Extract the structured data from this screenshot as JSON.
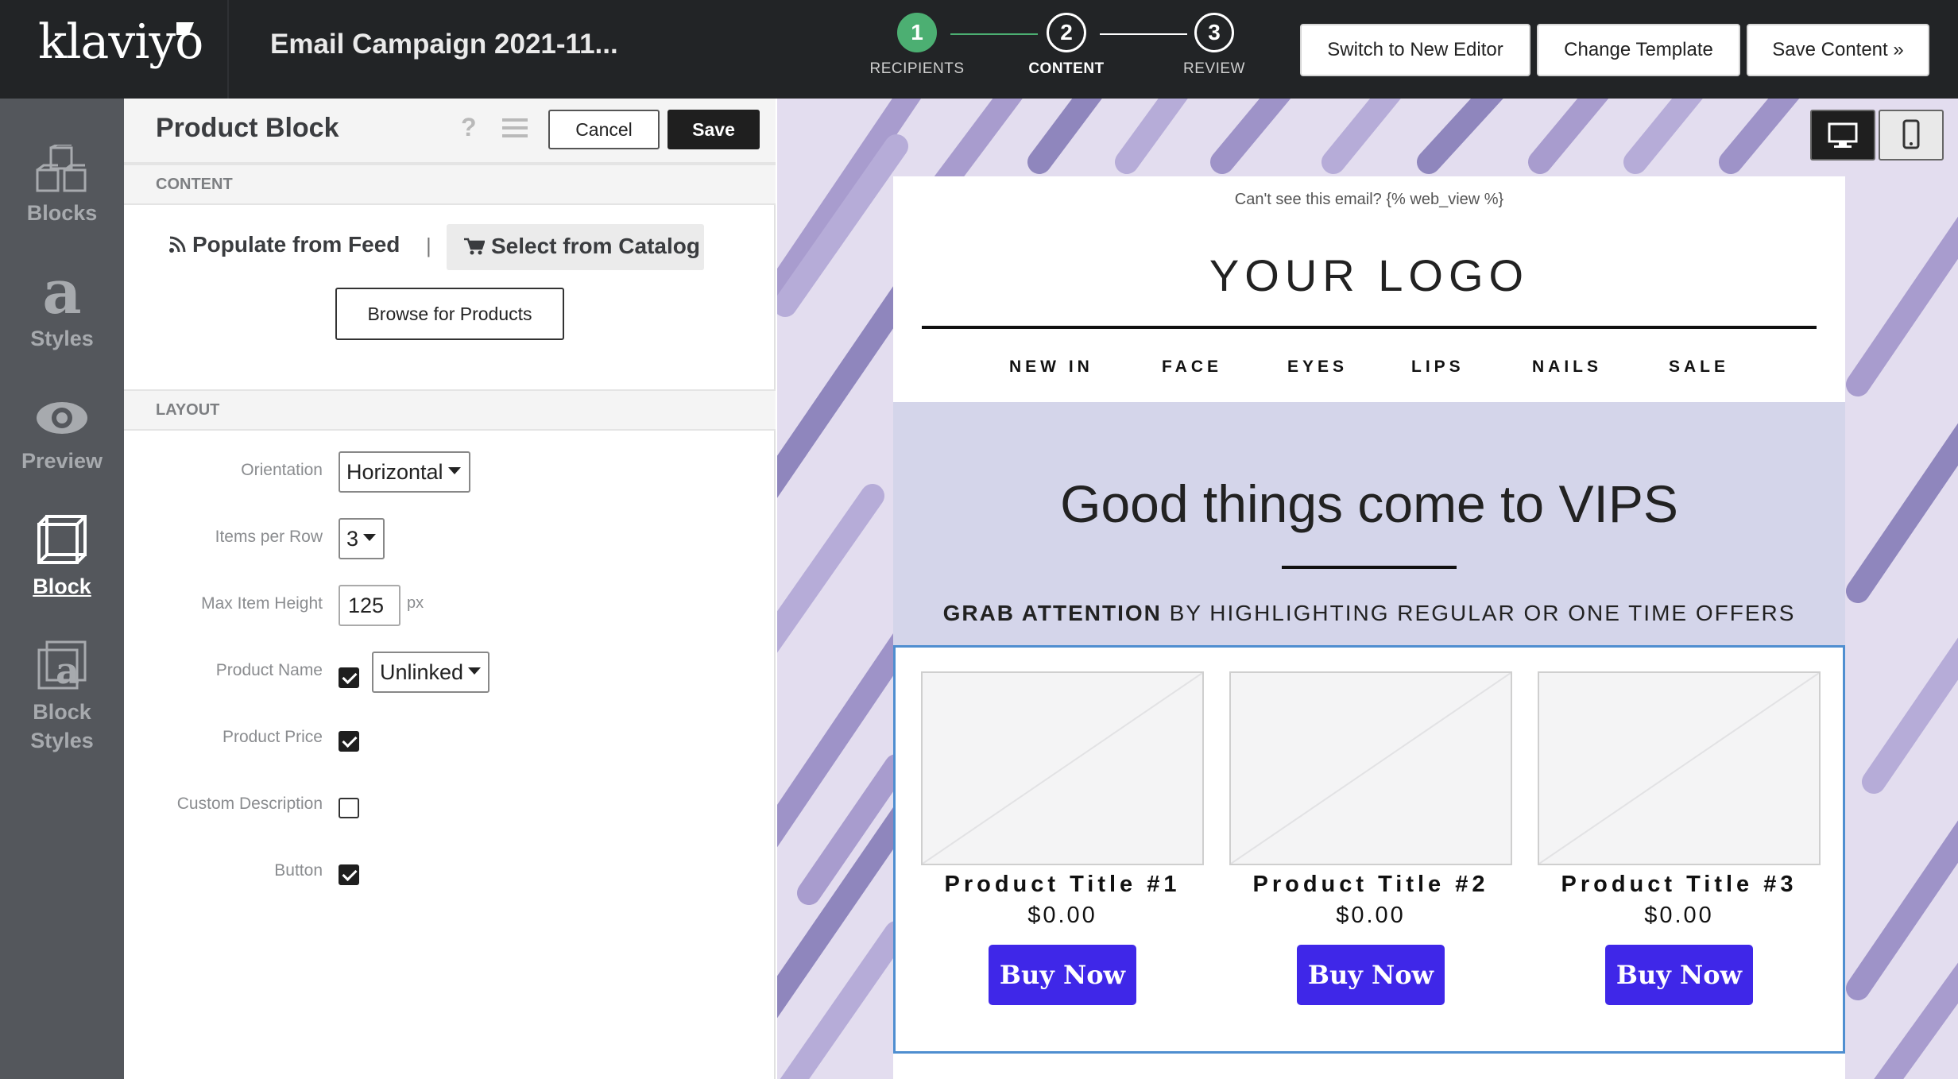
{
  "app": {
    "logo_text": "klaviyo",
    "campaign_title": "Email Campaign 2021-11..."
  },
  "steps": [
    {
      "number": "1",
      "label": "RECIPIENTS",
      "state": "done"
    },
    {
      "number": "2",
      "label": "CONTENT",
      "state": "active"
    },
    {
      "number": "3",
      "label": "REVIEW",
      "state": "todo"
    }
  ],
  "toolbar": {
    "switch_editor": "Switch to New Editor",
    "change_template": "Change Template",
    "save_content": "Save Content »"
  },
  "rail": {
    "items": [
      {
        "label": "Blocks",
        "icon": "blocks-icon"
      },
      {
        "label": "Styles",
        "icon": "styles-icon"
      },
      {
        "label": "Preview",
        "icon": "eye-icon"
      },
      {
        "label": "Block",
        "icon": "cube-icon",
        "active": true
      },
      {
        "label": "Block Styles",
        "icon": "block-styles-icon"
      }
    ]
  },
  "panel": {
    "title": "Product Block",
    "help_glyph": "?",
    "cancel": "Cancel",
    "save": "Save",
    "content_heading": "CONTENT",
    "populate_feed": "Populate from Feed",
    "separator": "|",
    "select_catalog": "Select from Catalog",
    "browse": "Browse for Products",
    "layout_heading": "LAYOUT",
    "fields": {
      "orientation_label": "Orientation",
      "orientation_value": "Horizontal",
      "items_per_row_label": "Items per Row",
      "items_per_row_value": "3",
      "max_height_label": "Max Item Height",
      "max_height_value": "125",
      "max_height_unit": "px",
      "product_name_label": "Product Name",
      "product_name_checked": true,
      "product_name_link": "Unlinked",
      "product_price_label": "Product Price",
      "product_price_checked": true,
      "custom_desc_label": "Custom Description",
      "custom_desc_checked": false,
      "button_label": "Button",
      "button_checked": true
    }
  },
  "email": {
    "webview": "Can't see this email? {% web_view %}",
    "logo": "YOUR LOGO",
    "nav": [
      "NEW IN",
      "FACE",
      "EYES",
      "LIPS",
      "NAILS",
      "SALE"
    ],
    "hero_title": "Good things come to VIPS",
    "hero_sub_bold": "GRAB ATTENTION",
    "hero_sub_rest": " BY HIGHLIGHTING REGULAR OR ONE TIME OFFERS",
    "products": [
      {
        "title": "Product Title #1",
        "price": "$0.00",
        "button": "Buy Now"
      },
      {
        "title": "Product Title #2",
        "price": "$0.00",
        "button": "Buy Now"
      },
      {
        "title": "Product Title #3",
        "price": "$0.00",
        "button": "Buy Now"
      }
    ]
  },
  "colors": {
    "topbar": "#222426",
    "rail": "#54575c",
    "step_done": "#4caf72",
    "buy_button": "#3f27e8",
    "hero_bg": "#d4d5ea",
    "selection_border": "#4f8ed0"
  }
}
